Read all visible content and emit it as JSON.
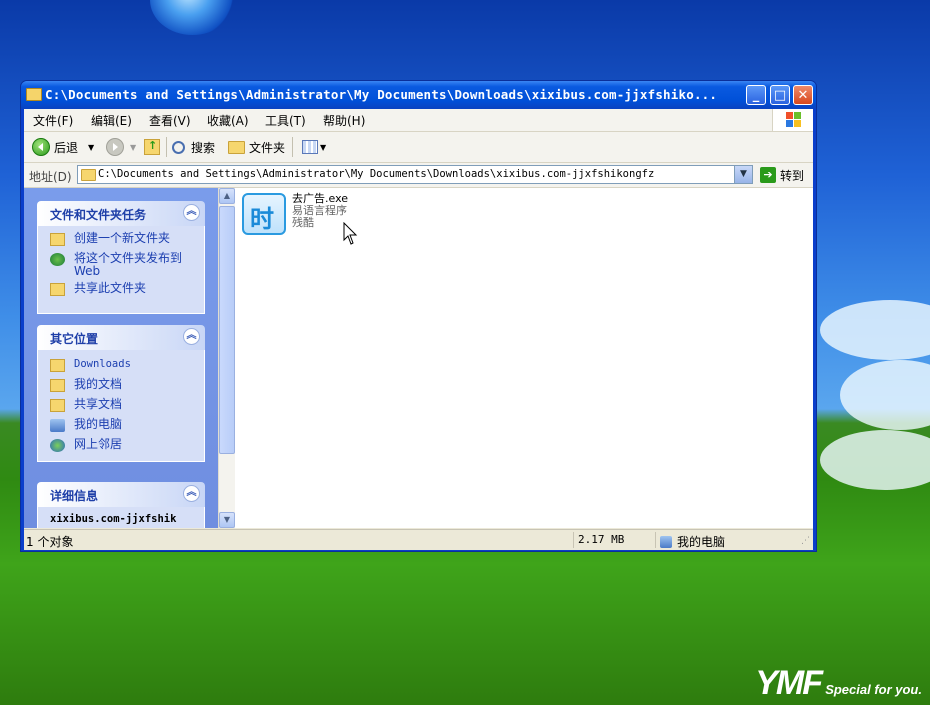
{
  "window": {
    "title": "C:\\Documents and Settings\\Administrator\\My Documents\\Downloads\\xixibus.com-jjxfshiko...",
    "buttons": {
      "minimize": "_",
      "maximize": "□",
      "close": "✕"
    }
  },
  "menu": [
    {
      "label": "文件(F)"
    },
    {
      "label": "编辑(E)"
    },
    {
      "label": "查看(V)"
    },
    {
      "label": "收藏(A)"
    },
    {
      "label": "工具(T)"
    },
    {
      "label": "帮助(H)"
    }
  ],
  "toolbar": {
    "back_label": "后退",
    "search_label": "搜索",
    "folders_label": "文件夹"
  },
  "address": {
    "label": "地址(D)",
    "value": "C:\\Documents and Settings\\Administrator\\My Documents\\Downloads\\xixibus.com-jjxfshikongfz",
    "go_label": "转到"
  },
  "panels": {
    "tasks": {
      "title": "文件和文件夹任务",
      "items": [
        {
          "label": "创建一个新文件夹",
          "icon": "new-folder-icon"
        },
        {
          "label": "将这个文件夹发布到 Web",
          "icon": "publish-web-icon"
        },
        {
          "label": "共享此文件夹",
          "icon": "share-folder-icon"
        }
      ]
    },
    "places": {
      "title": "其它位置",
      "items": [
        {
          "label": "Downloads",
          "icon": "folder-icon"
        },
        {
          "label": "我的文档",
          "icon": "my-documents-icon"
        },
        {
          "label": "共享文档",
          "icon": "shared-folder-icon"
        },
        {
          "label": "我的电脑",
          "icon": "my-computer-icon"
        },
        {
          "label": "网上邻居",
          "icon": "network-icon"
        }
      ]
    },
    "details": {
      "title": "详细信息",
      "name": "xixibus.com-jjxfshik"
    }
  },
  "file": {
    "name": "去广告.exe",
    "description": "易语言程序",
    "company": "残酷",
    "icon": "exe-icon"
  },
  "status": {
    "count": "1 个对象",
    "size": "2.17 MB",
    "location": "我的电脑"
  },
  "desktop": {
    "brand": "YMF",
    "tagline": "Special for you."
  }
}
